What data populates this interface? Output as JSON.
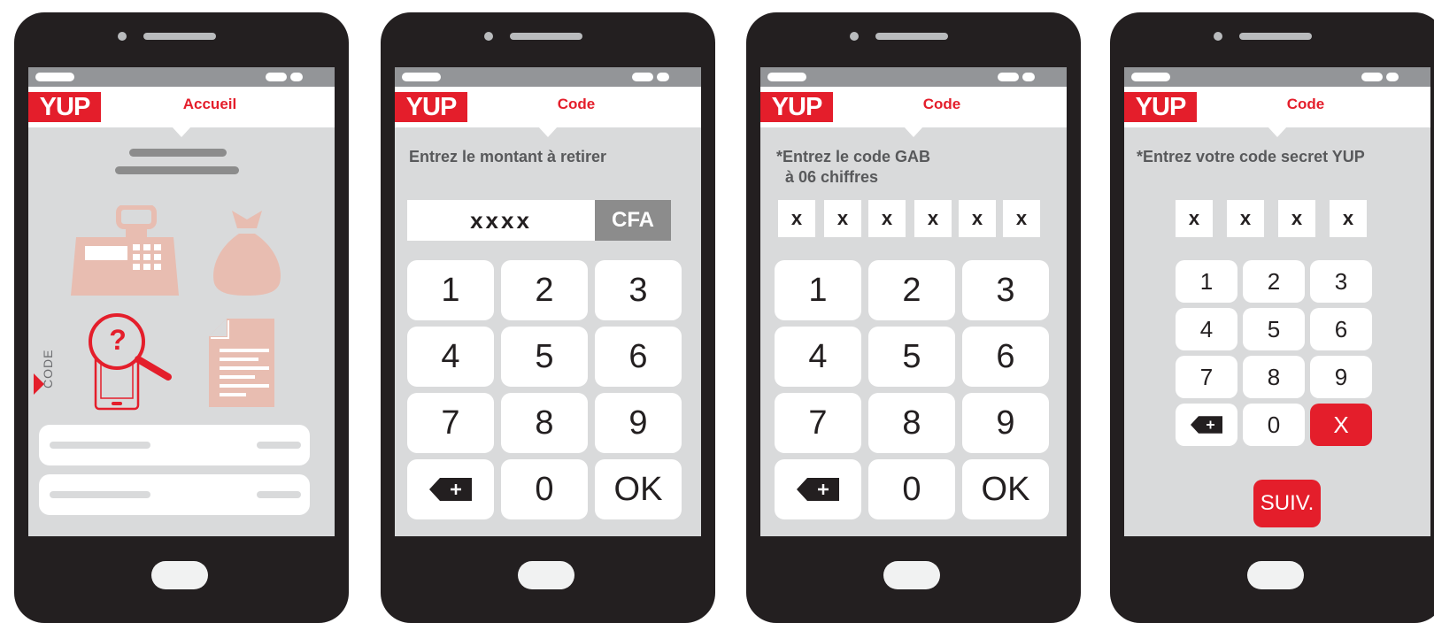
{
  "brand": {
    "logo_text": "YUP",
    "accent": "#e41e2b"
  },
  "screens": [
    {
      "title": "Accueil",
      "side_label": "CODE",
      "icons": [
        "cash-register-icon",
        "money-bag-icon",
        "phone-help-search-icon",
        "document-icon"
      ],
      "help_symbol": "?"
    },
    {
      "title": "Code",
      "prompt": "Entrez le montant à retirer",
      "amount": "xxxx",
      "currency": "CFA",
      "keys": [
        "1",
        "2",
        "3",
        "4",
        "5",
        "6",
        "7",
        "8",
        "9",
        "backspace",
        "0",
        "OK"
      ]
    },
    {
      "title": "Code",
      "prompt": "*Entrez le code GAB\n  à 06 chiffres",
      "digits": [
        "x",
        "x",
        "x",
        "x",
        "x",
        "x"
      ],
      "keys": [
        "1",
        "2",
        "3",
        "4",
        "5",
        "6",
        "7",
        "8",
        "9",
        "backspace",
        "0",
        "OK"
      ]
    },
    {
      "title": "Code",
      "prompt": "*Entrez votre code secret YUP",
      "digits": [
        "x",
        "x",
        "x",
        "x"
      ],
      "keys": [
        "1",
        "2",
        "3",
        "4",
        "5",
        "6",
        "7",
        "8",
        "9",
        "backspace",
        "0",
        "X"
      ],
      "next_label": "SUIV."
    }
  ]
}
